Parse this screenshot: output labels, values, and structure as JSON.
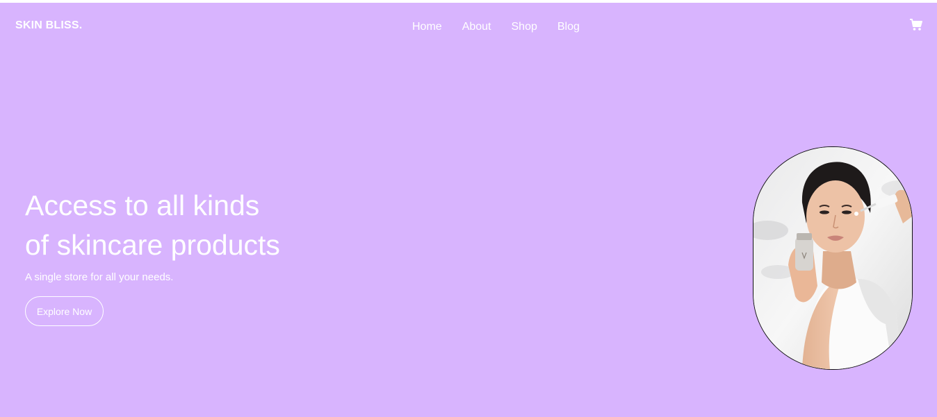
{
  "brand": "SKIN BLISS.",
  "nav": {
    "items": [
      {
        "label": "Home"
      },
      {
        "label": "About"
      },
      {
        "label": "Shop"
      },
      {
        "label": "Blog"
      }
    ]
  },
  "cart_icon": "shopping-cart-icon",
  "hero": {
    "title_line1": "Access to all kinds",
    "title_line2": "of skincare products",
    "subtitle": "A single store for all your needs.",
    "cta_label": "Explore Now"
  },
  "image": {
    "description_icon": "model-portrait-image"
  },
  "colors": {
    "background": "#d8b4fe",
    "text": "#ffffff",
    "portrait_border": "#111111"
  }
}
